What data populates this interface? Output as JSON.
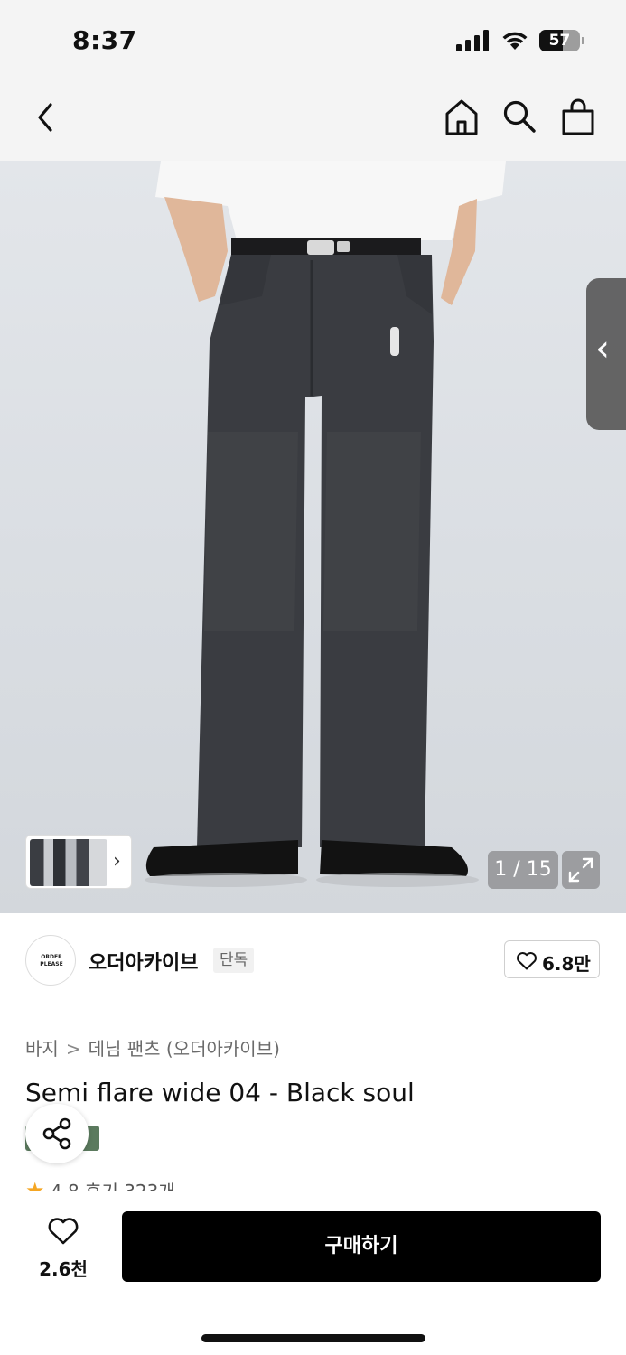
{
  "status_bar": {
    "time": "8:37",
    "battery_percent": 57
  },
  "nav": {
    "icons": [
      "chevron-left-icon",
      "home-icon",
      "search-icon",
      "shopping-bag-icon"
    ]
  },
  "gallery": {
    "counter": "1 / 15",
    "current_index": 1,
    "total_images": 15
  },
  "brand": {
    "logo_text_line1": "ORDER",
    "logo_text_line2": "PLEASE",
    "name": "오더아카이브",
    "badge": "단독",
    "like_count": "6.8만"
  },
  "product": {
    "breadcrumb": [
      "바지",
      "데님 팬츠 (오더아카이브)"
    ],
    "breadcrumb_separator": ">",
    "title": "Semi flare wide 04 - Black soul",
    "rating": "4.8",
    "review_label": "후기 323개"
  },
  "bottom_bar": {
    "wish_count": "2.6천",
    "buy_label": "구매하기"
  },
  "colors": {
    "accent_black": "#000000",
    "tag_green": "#5b7a5e",
    "star": "#f5a623"
  }
}
